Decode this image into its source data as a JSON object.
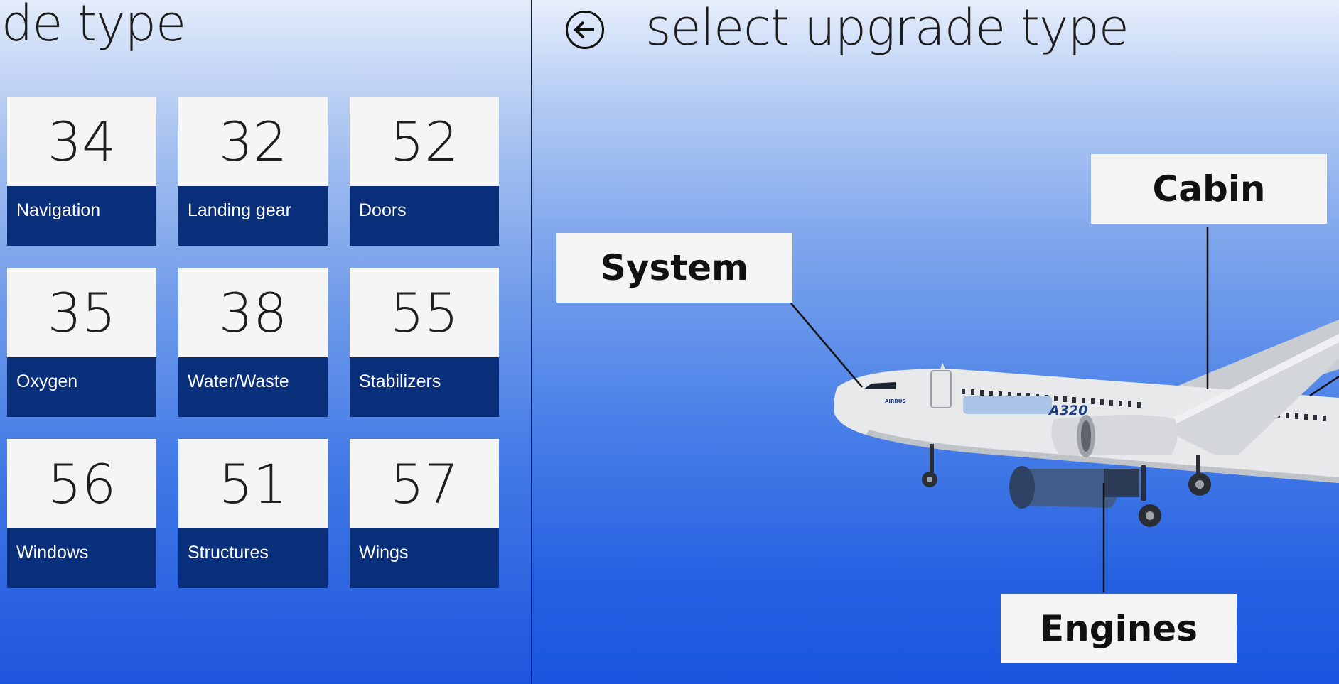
{
  "left": {
    "title": "ade type",
    "tiles": [
      {
        "number": "34",
        "label": "Navigation"
      },
      {
        "number": "32",
        "label": "Landing gear"
      },
      {
        "number": "52",
        "label": "Doors"
      },
      {
        "number": "35",
        "label": "Oxygen"
      },
      {
        "number": "38",
        "label": "Water/Waste"
      },
      {
        "number": "55",
        "label": "Stabilizers"
      },
      {
        "number": "56",
        "label": "Windows"
      },
      {
        "number": "51",
        "label": "Structures"
      },
      {
        "number": "57",
        "label": "Wings"
      }
    ]
  },
  "right": {
    "title": "select upgrade type",
    "back_icon": "back-arrow-icon",
    "callouts": {
      "system": "System",
      "cabin": "Cabin",
      "engines": "Engines"
    },
    "aircraft": {
      "model_text": "A320",
      "brand_text": "AIRBUS"
    }
  }
}
